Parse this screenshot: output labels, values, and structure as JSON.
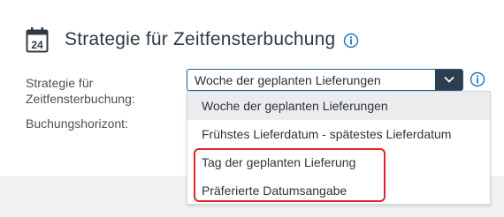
{
  "section": {
    "title": "Strategie für Zeitfensterbuchung",
    "icon": "calendar-icon",
    "calendar_day": "24",
    "info_icon": "info-icon"
  },
  "form": {
    "strategy_label": "Strategie für Zeitfensterbuchung:",
    "horizon_label": "Buchungshorizont:",
    "strategy_select": {
      "selected_value": "Woche der geplanten Lieferungen",
      "toggle_icon": "chevron-down-icon"
    },
    "field_info_icon": "info-icon"
  },
  "dropdown": {
    "options": [
      {
        "label": "Woche der geplanten Lieferungen",
        "selected": true
      },
      {
        "label": "Frühstes Lieferdatum - spätestes Lieferdatum",
        "selected": false
      },
      {
        "label": "Tag der geplanten Lieferung",
        "selected": false
      },
      {
        "label": "Präferierte Datumsangabe",
        "selected": false
      }
    ]
  },
  "colors": {
    "accent_blue": "#1f6fc5",
    "select_button": "#2d3e4e",
    "highlight_red": "#e0262b",
    "selected_option_bg": "#ebecee"
  }
}
